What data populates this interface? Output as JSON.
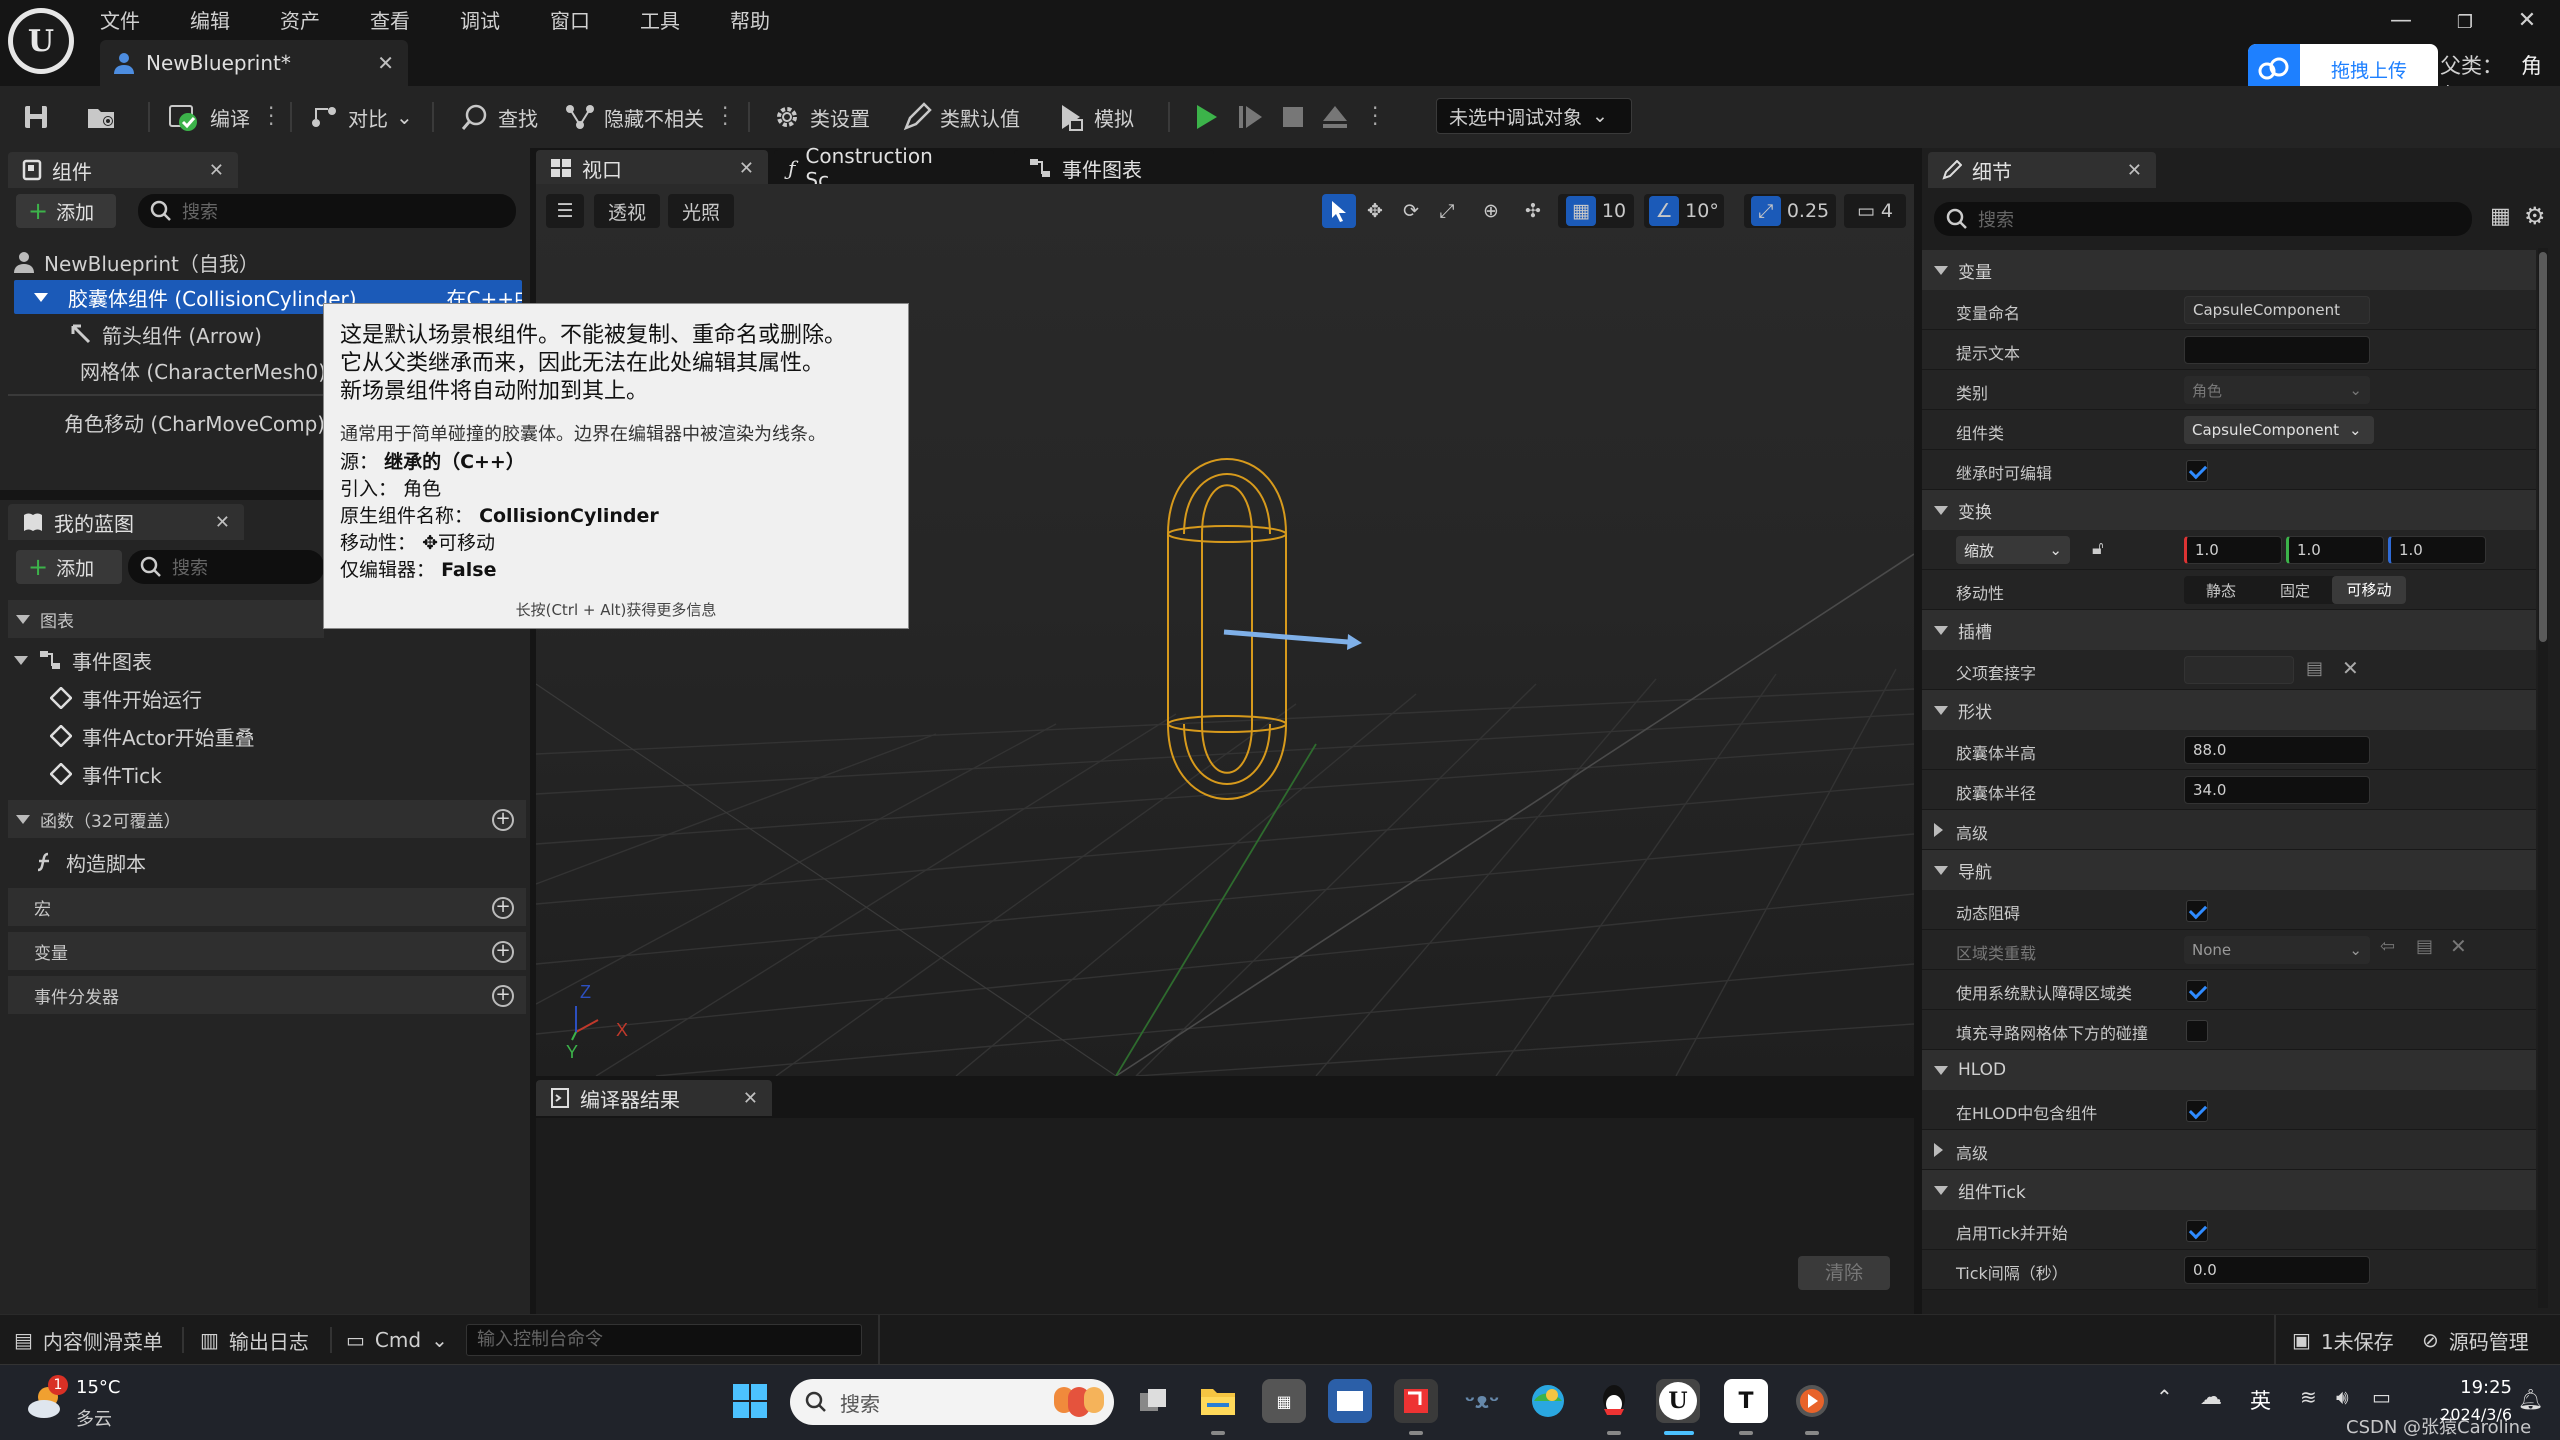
{
  "app": {
    "menu": [
      "文件",
      "编辑",
      "资产",
      "查看",
      "调试",
      "窗口",
      "工具",
      "帮助"
    ],
    "doc_tab": "NewBlueprint*",
    "upload_label": "拖拽上传",
    "parent_class_label": "父类：",
    "parent_class_value": "角色"
  },
  "toolbar": {
    "compile": "编译",
    "diff": "对比",
    "find": "查找",
    "hide_unrelated": "隐藏不相关",
    "class_settings": "类设置",
    "class_defaults": "类默认值",
    "simulate": "模拟",
    "debug_select": "未选中调试对象"
  },
  "components_panel": {
    "tab": "组件",
    "add": "添加",
    "search_placeholder": "搜索",
    "items": [
      {
        "label": "NewBlueprint（自我）"
      },
      {
        "label": "胶囊体组件 (CollisionCylinder)",
        "suffix": "在C++中编辑"
      },
      {
        "label": "箭头组件 (Arrow)"
      },
      {
        "label": "网格体 (CharacterMesh0)"
      },
      {
        "label": "角色移动 (CharMoveComp)"
      }
    ]
  },
  "my_blueprint": {
    "tab": "我的蓝图",
    "add": "添加",
    "search_placeholder": "搜索",
    "graphs_header": "图表",
    "event_graph": "事件图表",
    "events": [
      "事件开始运行",
      "事件Actor开始重叠",
      "事件Tick"
    ],
    "functions_header": "函数（32可覆盖）",
    "construction_script": "构造脚本",
    "macros_header": "宏",
    "variables_header": "变量",
    "dispatchers_header": "事件分发器"
  },
  "editor_tabs": {
    "viewport": "视口",
    "construction": "Construction Sc...",
    "event_graph": "事件图表"
  },
  "viewport_toolbar": {
    "perspective": "透视",
    "lighting": "光照",
    "grid_snap": "10",
    "rot_snap": "10°",
    "scale_snap": "0.25",
    "camera_speed": "4"
  },
  "tooltip": {
    "title_lines": [
      "这是默认场景根组件。不能被复制、重命名或删除。",
      "它从父类继承而来，因此无法在此处编辑其属性。",
      "新场景组件将自动附加到其上。"
    ],
    "desc": "通常用于简单碰撞的胶囊体。边界在编辑器中被渲染为线条。",
    "source_label": "源：",
    "source_value": "继承的（C++）",
    "introduced_label": "引入：",
    "introduced_value": "角色",
    "native_label": "原生组件名称：",
    "native_value": "CollisionCylinder",
    "mobility_label": "移动性：",
    "mobility_value": "可移动",
    "editor_only_label": "仅编辑器：",
    "editor_only_value": "False",
    "hint": "长按(Ctrl + Alt)获得更多信息"
  },
  "compiler": {
    "tab": "编译器结果",
    "clear": "清除"
  },
  "details": {
    "tab": "细节",
    "search_placeholder": "搜索",
    "sections": {
      "variable": "变量",
      "transform": "变换",
      "sockets": "插槽",
      "shape": "形状",
      "advanced1": "高级",
      "navigation": "导航",
      "hlod": "HLOD",
      "advanced2": "高级",
      "component_tick": "组件Tick"
    },
    "rows": {
      "var_name_label": "变量命名",
      "var_name_value": "CapsuleComponent",
      "tooltip_label": "提示文本",
      "category_label": "类别",
      "category_value": "角色",
      "comp_class_label": "组件类",
      "comp_class_value": "CapsuleComponent",
      "editable_label": "继承时可编辑",
      "scale_label": "缩放",
      "scale_x": "1.0",
      "scale_y": "1.0",
      "scale_z": "1.0",
      "mobility_label": "移动性",
      "mobility_options": [
        "静态",
        "固定",
        "可移动"
      ],
      "parent_socket_label": "父项套接字",
      "half_height_label": "胶囊体半高",
      "half_height_value": "88.0",
      "radius_label": "胶囊体半径",
      "radius_value": "34.0",
      "dynamic_obstacle_label": "动态阻碍",
      "area_class_label": "区域类重载",
      "area_class_value": "None",
      "use_default_area_label": "使用系统默认障碍区域类",
      "fill_below_label": "填充寻路网格体下方的碰撞",
      "include_hlod_label": "在HLOD中包含组件",
      "tick_start_label": "启用Tick并开始",
      "tick_interval_label": "Tick间隔（秒）",
      "tick_interval_value": "0.0"
    }
  },
  "statusbar": {
    "content_drawer": "内容侧滑菜单",
    "output_log": "输出日志",
    "cmd": "Cmd",
    "console_placeholder": "输入控制台命令",
    "unsaved": "1未保存",
    "source_control": "源码管理"
  },
  "taskbar": {
    "temperature": "15°C",
    "weather": "多云",
    "weather_badge": "1",
    "search": "搜索",
    "ime": "英",
    "time": "19:25",
    "date": "2024/3/6",
    "watermark": "CSDN @张猿Caroline"
  },
  "colors": {
    "accent": "#1b5ab8",
    "capsule": "#d79a1c",
    "arrow": "#7fb0e8",
    "play_green": "#3cb34a",
    "upload_blue": "#1e80ff"
  }
}
